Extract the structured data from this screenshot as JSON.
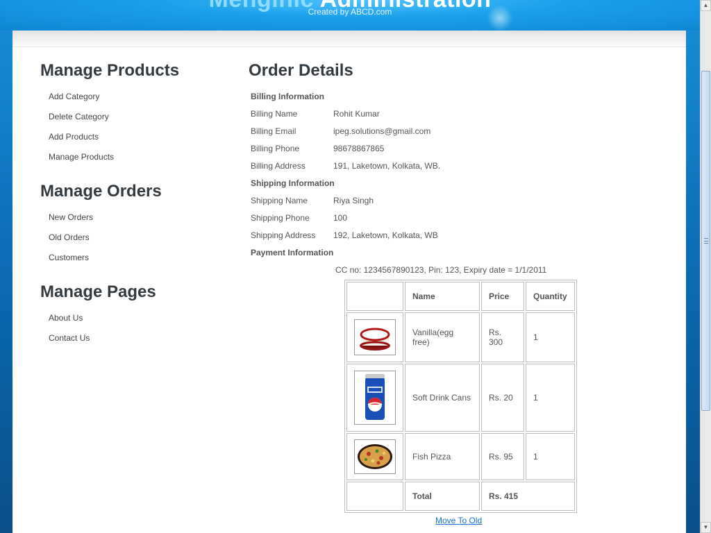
{
  "header": {
    "title_part1": "Menginic",
    "title_part2": "Administration",
    "subtitle": "Created by ABCD.com"
  },
  "sidebar": {
    "sections": [
      {
        "heading": "Manage Products",
        "items": [
          "Add Category",
          "Delete Category",
          "Add Products",
          "Manage Products"
        ]
      },
      {
        "heading": "Manage Orders",
        "items": [
          "New Orders",
          "Old Orders",
          "Customers"
        ]
      },
      {
        "heading": "Manage Pages",
        "items": [
          "About Us",
          "Contact Us"
        ]
      }
    ]
  },
  "order": {
    "title": "Order Details",
    "billing_heading": "Billing Information",
    "billing": [
      {
        "label": "Billing Name",
        "value": "Rohit Kumar"
      },
      {
        "label": "Billing Email",
        "value": "ipeg.solutions@gmail.com"
      },
      {
        "label": "Billing Phone",
        "value": "98678867865"
      },
      {
        "label": "Billing Address",
        "value": "191, Laketown, Kolkata, WB."
      }
    ],
    "shipping_heading": "Shipping Information",
    "shipping": [
      {
        "label": "Shipping Name",
        "value": "Riya Singh"
      },
      {
        "label": "Shipping Phone",
        "value": "100"
      },
      {
        "label": "Shipping Address",
        "value": "192, Laketown, Kolkata, WB"
      }
    ],
    "payment_heading": "Payment Information",
    "payment_text": "CC no: 1234567890123, Pin: 123, Expiry date = 1/1/2011",
    "table": {
      "headers": [
        "Name",
        "Price",
        "Quantity"
      ],
      "rows": [
        {
          "image": "cake-icon",
          "name": "Vanilla(egg free)",
          "price": "Rs. 300",
          "qty": "1"
        },
        {
          "image": "soda-can-icon",
          "name": "Soft Drink Cans",
          "price": "Rs. 20",
          "qty": "1"
        },
        {
          "image": "pizza-icon",
          "name": "Fish Pizza",
          "price": "Rs. 95",
          "qty": "1"
        }
      ],
      "total_label": "Total",
      "total_value": "Rs. 415"
    },
    "move_link": "Move To Old"
  },
  "colors": {
    "link": "#1a6fd0",
    "heading": "#333a40",
    "background_top": "#1a8fd8"
  }
}
